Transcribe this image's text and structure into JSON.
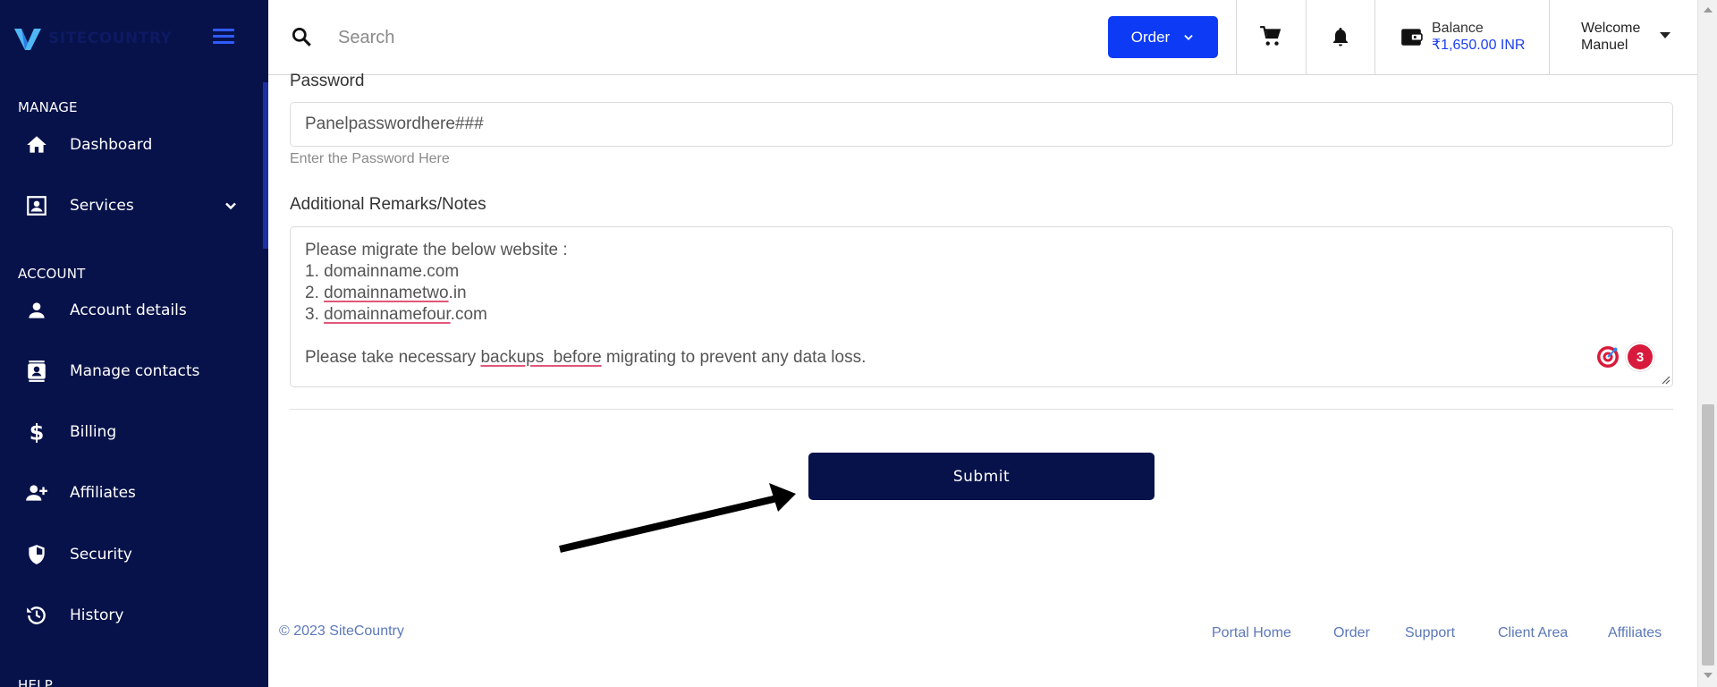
{
  "app": {
    "brand": "SITECOUNTRY"
  },
  "sidebar": {
    "sections": [
      {
        "label": "MANAGE"
      },
      {
        "label": "ACCOUNT"
      },
      {
        "label": "HELP"
      }
    ],
    "items": [
      {
        "label": "Dashboard",
        "icon": "home-icon"
      },
      {
        "label": "Services",
        "icon": "id-card-icon",
        "expandable": true
      },
      {
        "label": "Account details",
        "icon": "person-icon"
      },
      {
        "label": "Manage contacts",
        "icon": "contacts-icon"
      },
      {
        "label": "Billing",
        "icon": "dollar-icon"
      },
      {
        "label": "Affiliates",
        "icon": "add-user-icon"
      },
      {
        "label": "Security",
        "icon": "shield-icon"
      },
      {
        "label": "History",
        "icon": "history-icon"
      }
    ]
  },
  "header": {
    "search_placeholder": "Search",
    "order_label": "Order",
    "balance_label": "Balance",
    "balance_value": "₹1,650.00 INR",
    "welcome_label": "Welcome",
    "user_name": "Manuel"
  },
  "form": {
    "password_label": "Password",
    "password_value": "Panelpasswordhere###",
    "password_help": "Enter the Password Here",
    "notes_label": "Additional Remarks/Notes",
    "notes_lines": {
      "l1": "Please migrate the below website :",
      "l2": "1. domainname.com",
      "l3_prefix": "2. ",
      "l3_word": "domainnametwo",
      "l3_suffix": ".in",
      "l4_prefix": "3. ",
      "l4_word": "domainnamefour",
      "l4_suffix": ".com",
      "l6_prefix": "Please take necessary ",
      "l6_word": "backups  before",
      "l6_suffix": " migrating to prevent any data loss."
    },
    "grammar_badge_count": "3",
    "submit_label": "Submit"
  },
  "footer": {
    "copyright": "© 2023 SiteCountry",
    "links": [
      "Portal Home",
      "Order",
      "Support",
      "Client Area",
      "Affiliates"
    ]
  },
  "colors": {
    "sidebar_bg": "#07124a",
    "accent": "#0d3bf5",
    "submit_bg": "#07124a",
    "link": "#5b78b8"
  }
}
